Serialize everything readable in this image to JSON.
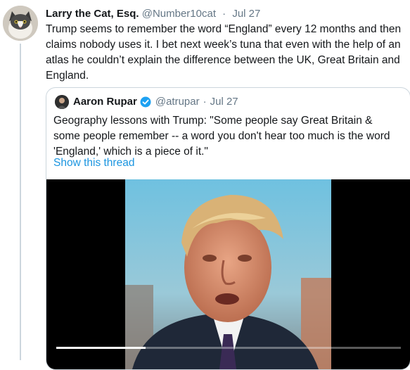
{
  "tweet": {
    "author_name": "Larry the Cat, Esq.",
    "author_handle": "@Number10cat",
    "separator": "·",
    "date": "Jul 27",
    "text": "Trump seems to remember the word “England” every 12 months and then claims nobody uses it. I bet next week’s tuna that even with the help of an atlas he couldn’t explain the difference between the UK, Great Britain and England."
  },
  "quote": {
    "author_name": "Aaron Rupar",
    "author_handle": "@atrupar",
    "separator": "·",
    "date": "Jul 27",
    "text": "Geography lessons with Trump: \"Some people say Great Britain & some people remember -- a word you don't hear too much is the word 'England,' which is a piece of it.\"",
    "show_thread": "Show this thread",
    "video_progress": 0.26
  },
  "icons": {
    "verified": "verified-badge-icon",
    "accent": "#1b95e0"
  }
}
